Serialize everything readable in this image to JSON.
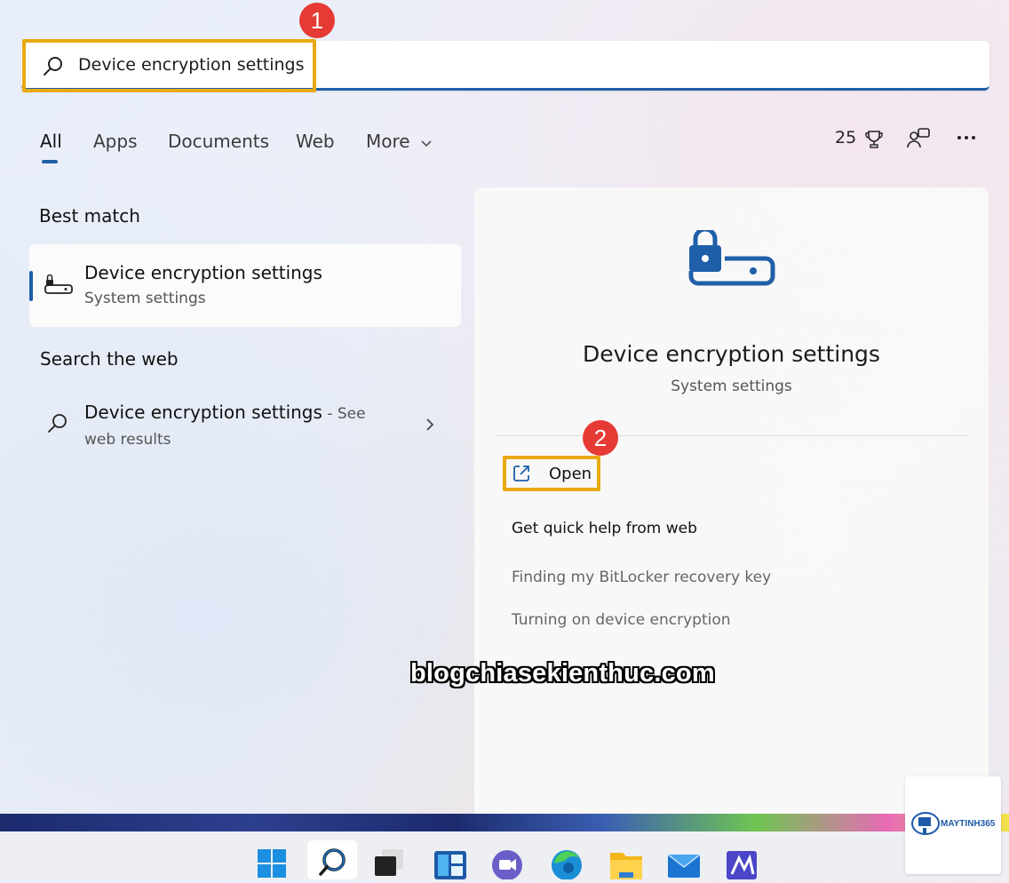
{
  "search": {
    "query": "Device encryption settings",
    "badge_number": "1"
  },
  "tabs": [
    {
      "label": "All",
      "active": true
    },
    {
      "label": "Apps"
    },
    {
      "label": "Documents"
    },
    {
      "label": "Web"
    },
    {
      "label": "More"
    }
  ],
  "header_right": {
    "points": "25"
  },
  "best_match": {
    "section_label": "Best match",
    "title": "Device encryption settings",
    "subtitle": "System settings"
  },
  "web_search": {
    "section_label": "Search the web",
    "title": "Device encryption settings",
    "suffix": " - See",
    "line2": "web results"
  },
  "detail": {
    "title": "Device encryption settings",
    "subtitle": "System settings",
    "open_label": "Open",
    "badge_number": "2",
    "quick_help_label": "Get quick help from web",
    "links": [
      "Finding my BitLocker recovery key",
      "Turning on device encryption"
    ]
  },
  "watermark": "blogchiasekienthuc.com",
  "logo_text": "MAYTINH365",
  "taskbar_icons": [
    "windows-start-icon",
    "search-icon",
    "task-view-icon",
    "widgets-icon",
    "teams-chat-icon",
    "edge-browser-icon",
    "file-explorer-icon",
    "mail-icon",
    "store-app-icon"
  ],
  "colors": {
    "accent": "#1f5fa8",
    "highlight": "#e8aa12",
    "badge": "#e63a35"
  }
}
